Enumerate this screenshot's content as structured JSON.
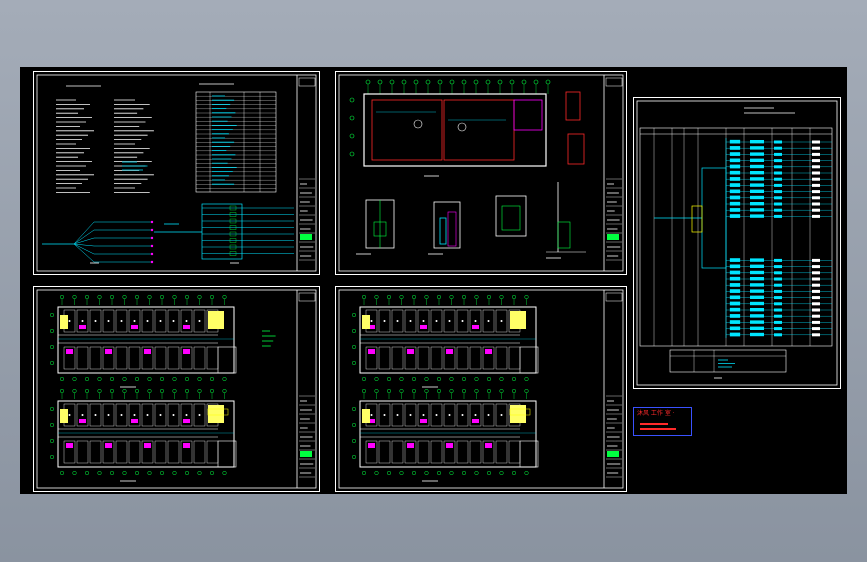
{
  "viewer": {
    "background_top": "#a4acb8",
    "background_bottom": "#8a93a0",
    "model_space_color": "#000000"
  },
  "colors": {
    "frame": "#ffffff",
    "wall": "#ffffff",
    "grid": "#00ff40",
    "text": "#ffffff",
    "circuit": "#00e5ff",
    "partition": "#ff2a2a",
    "room_fill": "#ffff66",
    "fixture": "#ff00ff",
    "annotation": "#ffff00"
  },
  "sheets": [
    {
      "id": "design-notes",
      "kind": "notes-and-legend"
    },
    {
      "id": "detail-plan",
      "kind": "enlarged-plan-and-sections"
    },
    {
      "id": "distribution-system",
      "kind": "riser-schedule"
    },
    {
      "id": "floor-plan-lower",
      "kind": "two-floor-plans"
    },
    {
      "id": "floor-plan-upper",
      "kind": "two-floor-plans"
    }
  ],
  "stamp": {
    "title_glyphs": "沐风 工作 室 ·",
    "accent": "#ff2a2a",
    "border": "#3a52ff"
  }
}
